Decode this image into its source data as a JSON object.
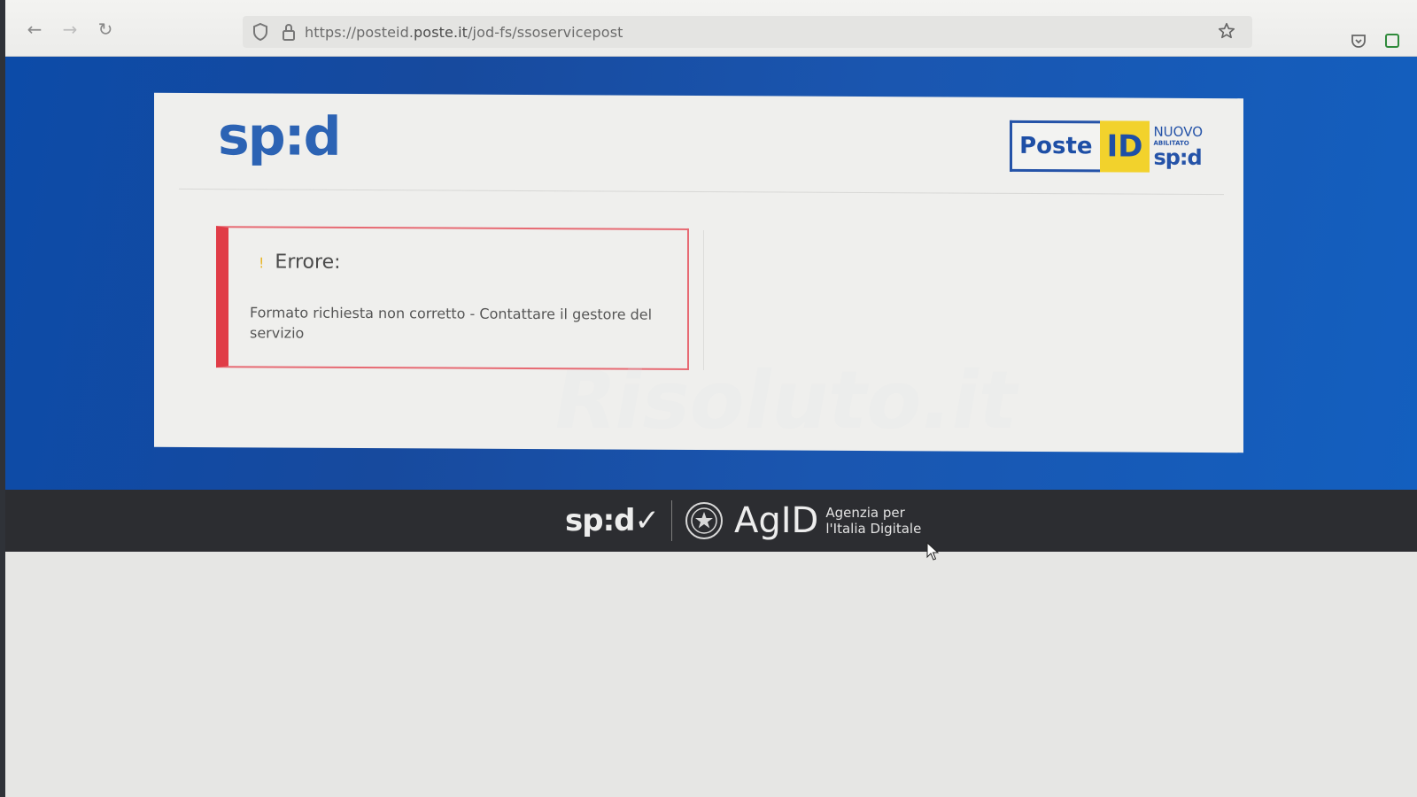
{
  "browser": {
    "url_prefix": "https://posteid.",
    "url_domain": "poste.it",
    "url_path": "/jod-fs/ssoservicepost"
  },
  "header": {
    "spid_logo_text": "sp:d",
    "posteid": {
      "poste": "Poste",
      "id": "ID",
      "nuovo": "NUOVO",
      "abilitato": "ABILITATO",
      "spid": "sp:d"
    }
  },
  "error": {
    "bang": "!",
    "title": "Errore:",
    "message": "Formato richiesta non corretto - Contattare il gestore del servizio"
  },
  "footer": {
    "spid_text": "sp:d✓",
    "agid_text": "AgID",
    "agency_line1": "Agenzia per",
    "agency_line2": "l'Italia Digitale"
  },
  "watermark": "Risoluto.it",
  "colors": {
    "brand_blue": "#2c63b4",
    "error_red": "#e03c47",
    "posteid_yellow": "#f2d22c",
    "footer_dark": "#2c2d31"
  }
}
